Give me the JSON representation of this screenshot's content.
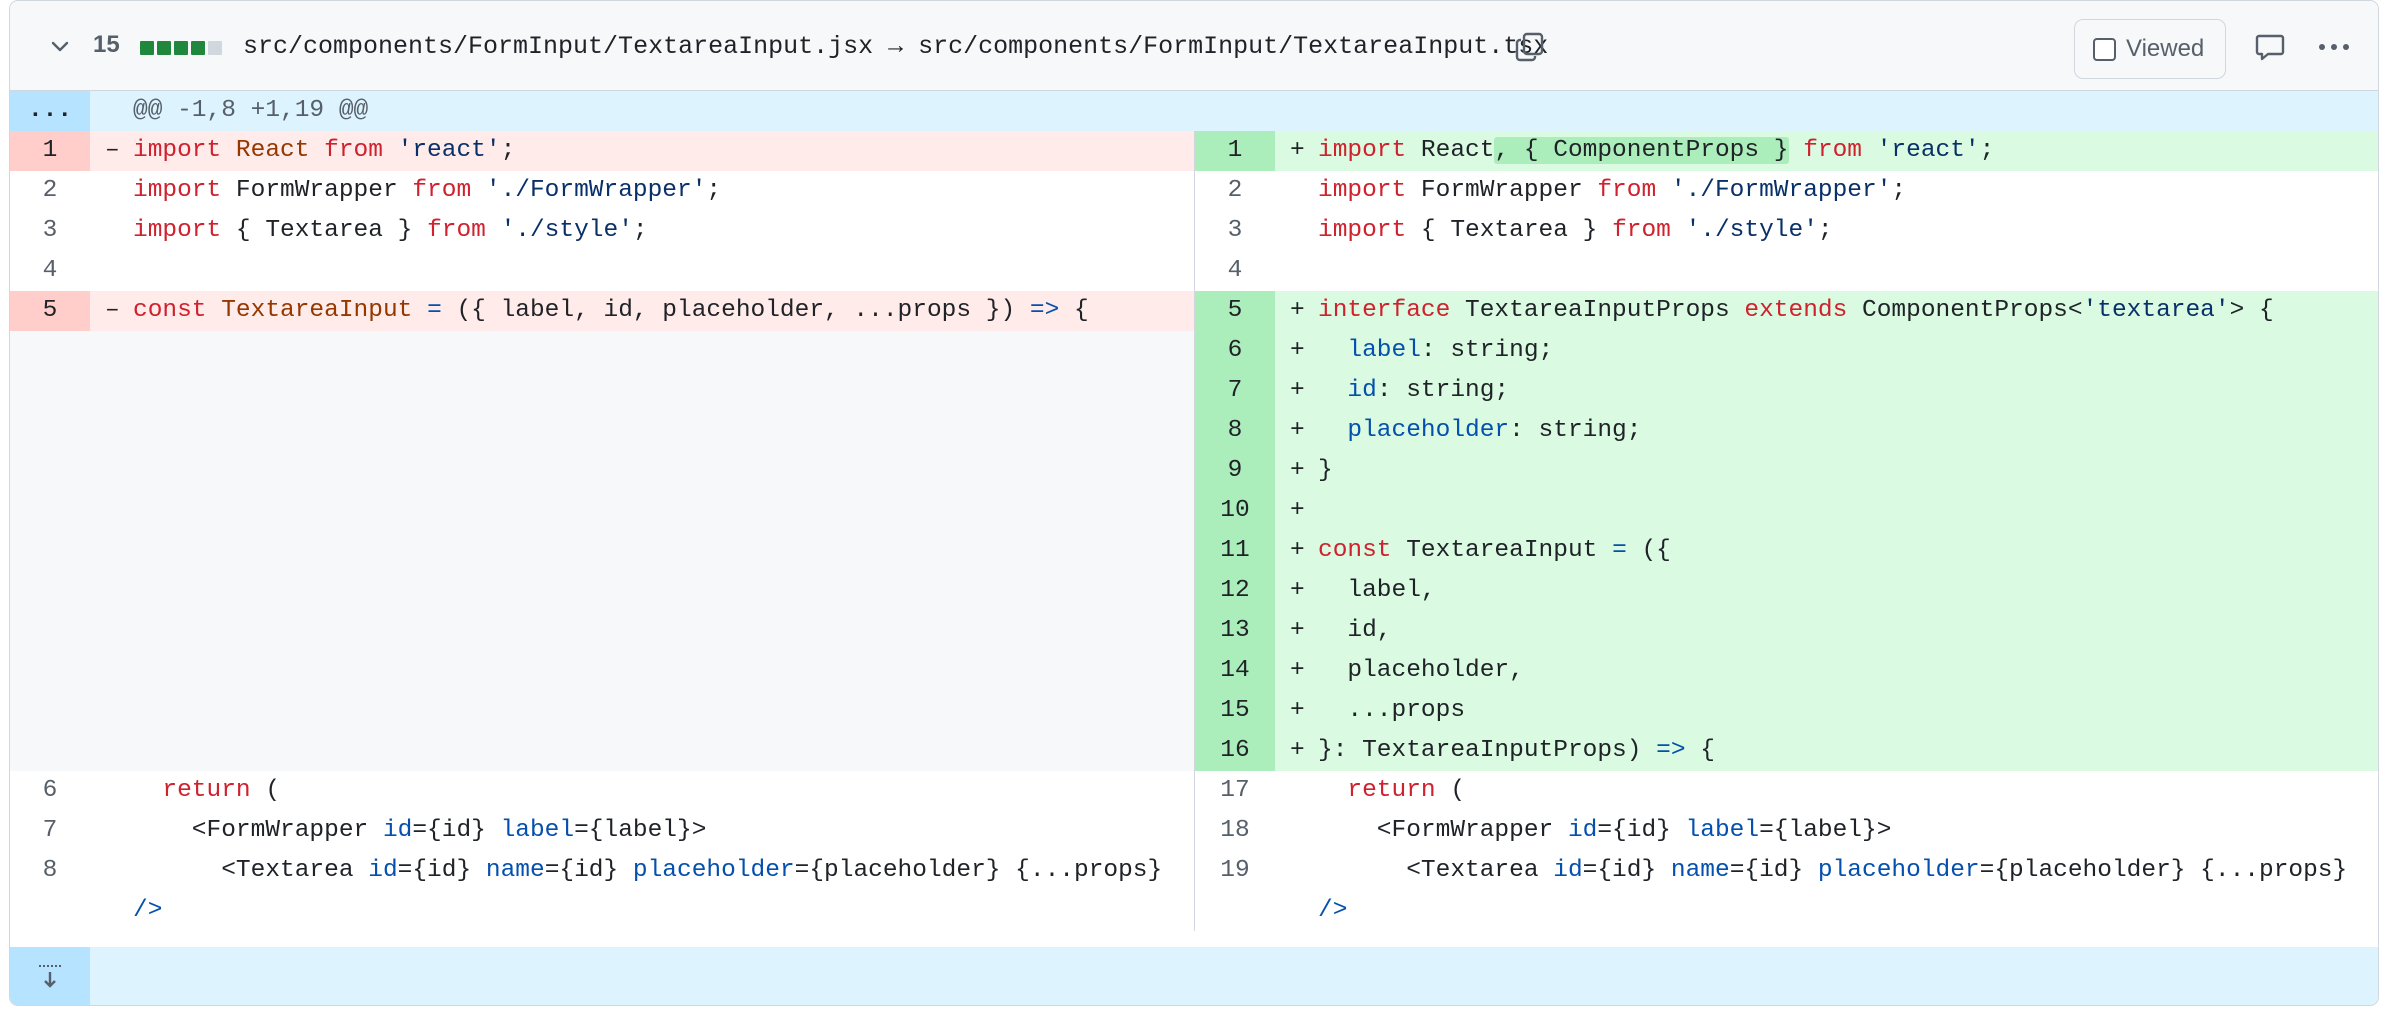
{
  "header": {
    "changes_count": "15",
    "path_text": "src/components/FormInput/TextareaInput.jsx → src/components/FormInput/TextareaInput.tsx",
    "viewed_label": "Viewed",
    "icons": [
      "chevron-down-icon",
      "copy-icon",
      "comment-icon",
      "kebab-icon"
    ]
  },
  "hunk": {
    "gutter": "...",
    "header": "@@ -1,8 +1,19 @@"
  },
  "left_lines": [
    {
      "num": "1",
      "marker": "–",
      "type": "del"
    },
    {
      "num": "2",
      "marker": "",
      "type": "ctx"
    },
    {
      "num": "3",
      "marker": "",
      "type": "ctx"
    },
    {
      "num": "4",
      "marker": "",
      "type": "ctx"
    },
    {
      "num": "5",
      "marker": "–",
      "type": "del"
    },
    {
      "num": "6",
      "marker": "",
      "type": "ctx"
    },
    {
      "num": "7",
      "marker": "",
      "type": "ctx"
    },
    {
      "num": "8",
      "marker": "",
      "type": "ctx"
    }
  ],
  "right_lines": [
    {
      "num": "1",
      "marker": "+",
      "type": "add"
    },
    {
      "num": "2",
      "marker": "",
      "type": "ctx"
    },
    {
      "num": "3",
      "marker": "",
      "type": "ctx"
    },
    {
      "num": "4",
      "marker": "",
      "type": "ctx"
    },
    {
      "num": "5",
      "marker": "+",
      "type": "add"
    },
    {
      "num": "6",
      "marker": "+",
      "type": "add"
    },
    {
      "num": "7",
      "marker": "+",
      "type": "add"
    },
    {
      "num": "8",
      "marker": "+",
      "type": "add"
    },
    {
      "num": "9",
      "marker": "+",
      "type": "add"
    },
    {
      "num": "10",
      "marker": "+",
      "type": "add"
    },
    {
      "num": "11",
      "marker": "+",
      "type": "add"
    },
    {
      "num": "12",
      "marker": "+",
      "type": "add"
    },
    {
      "num": "13",
      "marker": "+",
      "type": "add"
    },
    {
      "num": "14",
      "marker": "+",
      "type": "add"
    },
    {
      "num": "15",
      "marker": "+",
      "type": "add"
    },
    {
      "num": "16",
      "marker": "+",
      "type": "add"
    },
    {
      "num": "17",
      "marker": "",
      "type": "ctx"
    },
    {
      "num": "18",
      "marker": "",
      "type": "ctx"
    },
    {
      "num": "19",
      "marker": "",
      "type": "ctx"
    }
  ],
  "code": {
    "l1": [
      "import",
      " React ",
      "from",
      " ",
      "'react'",
      ";"
    ],
    "l2": [
      "import",
      " FormWrapper ",
      "from",
      " ",
      "'./FormWrapper'",
      ";"
    ],
    "l3": [
      "import",
      " { Textarea } ",
      "from",
      " ",
      "'./style'",
      ";"
    ],
    "l5": [
      "const",
      " TextareaInput ",
      "=",
      " ({ label, id, placeholder, ...props }) ",
      "=>",
      " {"
    ],
    "l6": [
      "  ",
      "return",
      " ("
    ],
    "l7": [
      "    <FormWrapper ",
      "id",
      "={id} ",
      "label",
      "={label}>"
    ],
    "l8": [
      "      <Textarea ",
      "id",
      "={id} ",
      "name",
      "={id} ",
      "placeholder",
      "={placeholder} {...props}"
    ],
    "l8b": "/>",
    "r1": [
      "import",
      " React",
      ", { ComponentProps }",
      " ",
      "from",
      " ",
      "'react'",
      ";"
    ],
    "r5": [
      "interface",
      " TextareaInputProps ",
      "extends",
      " ComponentProps<",
      "'textarea'",
      "> {"
    ],
    "r6": [
      "  ",
      "label",
      ": string;"
    ],
    "r7": [
      "  ",
      "id",
      ": string;"
    ],
    "r8": [
      "  ",
      "placeholder",
      ": string;"
    ],
    "r9": "}",
    "r11": [
      "const",
      " TextareaInput ",
      "=",
      " ({"
    ],
    "r12": "  label,",
    "r13": "  id,",
    "r14": "  placeholder,",
    "r15": "  ...props",
    "r16": [
      "}: TextareaInputProps) ",
      "=>",
      " {"
    ]
  }
}
